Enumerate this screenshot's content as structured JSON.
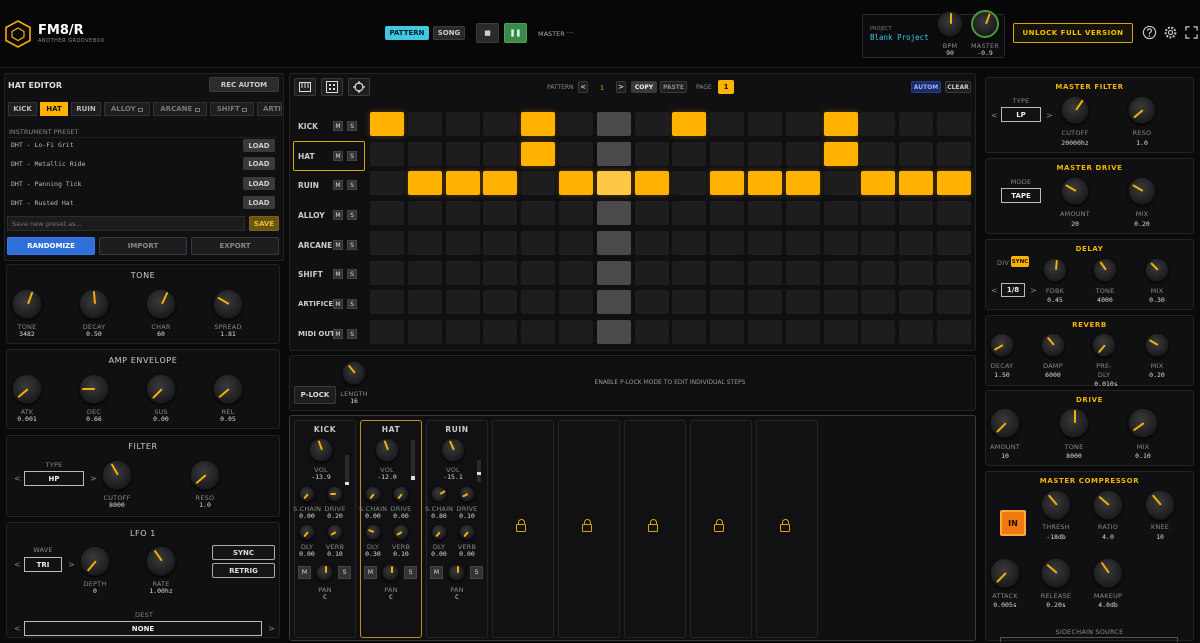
{
  "app": {
    "logo_title": "FM8/R",
    "logo_subtitle": "ANOTHER GROOVEBOX"
  },
  "transport": {
    "pattern_label": "PATTERN",
    "song_label": "SONG",
    "stop_glyph": "■",
    "pause_glyph": "❚❚",
    "master_label": "MASTER",
    "master_value": "---"
  },
  "project": {
    "label": "PROJECT",
    "name": "Blank Project",
    "bpm_label": "BPM",
    "bpm_value": "90",
    "master_label": "MASTER",
    "master_value": "-0.9",
    "unlock_label": "UNLOCK FULL VERSION"
  },
  "editor": {
    "title": "HAT EDITOR",
    "rec_label": "REC AUTOM",
    "tabs": [
      "KICK",
      "HAT",
      "RUIN",
      "ALLOY",
      "ARCANE",
      "SHIFT",
      "ARTI"
    ],
    "preset_heading": "INSTRUMENT PRESET",
    "presets": [
      {
        "name": "DHT - Lo-Fi Grit",
        "action": "LOAD"
      },
      {
        "name": "DHT - Metallic Ride",
        "action": "LOAD"
      },
      {
        "name": "DHT - Panning Tick",
        "action": "LOAD"
      },
      {
        "name": "DHT - Rusted Hat",
        "action": "LOAD"
      }
    ],
    "save_placeholder": "Save new preset as...",
    "save_label": "SAVE",
    "randomize_label": "RANDOMIZE",
    "import_label": "IMPORT",
    "export_label": "EXPORT",
    "tone": {
      "title": "TONE",
      "knobs": [
        {
          "label": "TONE",
          "value": "3482"
        },
        {
          "label": "DECAY",
          "value": "0.50"
        },
        {
          "label": "CHAR",
          "value": "60"
        },
        {
          "label": "SPREAD",
          "value": "1.81"
        }
      ]
    },
    "amp": {
      "title": "AMP ENVELOPE",
      "knobs": [
        {
          "label": "ATK",
          "value": "0.001"
        },
        {
          "label": "DEC",
          "value": "0.66"
        },
        {
          "label": "SUS",
          "value": "0.00"
        },
        {
          "label": "REL",
          "value": "0.05"
        }
      ]
    },
    "filter": {
      "title": "FILTER",
      "type_label": "TYPE",
      "type_value": "HP",
      "arrow_left": "<",
      "arrow_right": ">",
      "knobs": [
        {
          "label": "CUTOFF",
          "value": "8000"
        },
        {
          "label": "RESO",
          "value": "1.0"
        }
      ]
    },
    "lfo": {
      "title": "LFO 1",
      "wave_label": "WAVE",
      "wave_value": "TRI",
      "arrow_left": "<",
      "arrow_right": ">",
      "knobs": [
        {
          "label": "DEPTH",
          "value": "0"
        },
        {
          "label": "RATE",
          "value": "1.00hz"
        }
      ],
      "sync_label": "SYNC",
      "retrig_label": "RETRIG",
      "dest_label": "DEST",
      "dest_value": "NONE"
    }
  },
  "sequencer": {
    "pattern_label": "PATTERN",
    "pattern_prev": "<",
    "pattern_value": "1",
    "pattern_next": ">",
    "copy_label": "COPY",
    "paste_label": "PASTE",
    "page_label": "PAGE",
    "page_value": "1",
    "autom_label": "AUTOM",
    "clear_label": "CLEAR",
    "mute_label": "M",
    "solo_label": "S",
    "tracks": [
      {
        "name": "KICK",
        "steps": [
          1,
          0,
          0,
          0,
          1,
          0,
          0,
          0,
          1,
          0,
          0,
          0,
          1,
          0,
          0,
          0
        ]
      },
      {
        "name": "HAT",
        "steps": [
          0,
          0,
          0,
          0,
          1,
          0,
          0,
          0,
          0,
          0,
          0,
          0,
          1,
          0,
          0,
          0
        ]
      },
      {
        "name": "RUIN",
        "steps": [
          0,
          1,
          1,
          1,
          0,
          1,
          1,
          1,
          0,
          1,
          1,
          1,
          0,
          1,
          1,
          1
        ]
      },
      {
        "name": "ALLOY",
        "steps": [
          0,
          0,
          0,
          0,
          0,
          0,
          0,
          0,
          0,
          0,
          0,
          0,
          0,
          0,
          0,
          0
        ]
      },
      {
        "name": "ARCANE",
        "steps": [
          0,
          0,
          0,
          0,
          0,
          0,
          0,
          0,
          0,
          0,
          0,
          0,
          0,
          0,
          0,
          0
        ]
      },
      {
        "name": "SHIFT",
        "steps": [
          0,
          0,
          0,
          0,
          0,
          0,
          0,
          0,
          0,
          0,
          0,
          0,
          0,
          0,
          0,
          0
        ]
      },
      {
        "name": "ARTIFICE",
        "steps": [
          0,
          0,
          0,
          0,
          0,
          0,
          0,
          0,
          0,
          0,
          0,
          0,
          0,
          0,
          0,
          0
        ]
      },
      {
        "name": "MIDI OUT",
        "steps": [
          0,
          0,
          0,
          0,
          0,
          0,
          0,
          0,
          0,
          0,
          0,
          0,
          0,
          0,
          0,
          0
        ]
      }
    ],
    "playhead_step": 6,
    "plock_label": "P-LOCK",
    "length_label": "LENGTH",
    "length_value": "16",
    "hint": "ENABLE P-LOCK MODE TO EDIT INDIVIDUAL STEPS"
  },
  "mixer": {
    "channels": [
      {
        "name": "KICK",
        "vol": "-13.9",
        "schain": "0.00",
        "drive": "0.20",
        "dly": "0.00",
        "verb": "0.10",
        "pan": "C"
      },
      {
        "name": "HAT",
        "vol": "-12.0",
        "schain": "0.00",
        "drive": "0.00",
        "dly": "0.30",
        "verb": "0.10",
        "pan": "C"
      },
      {
        "name": "RUIN",
        "vol": "-15.1",
        "schain": "0.80",
        "drive": "0.10",
        "dly": "0.00",
        "verb": "0.00",
        "pan": "C"
      }
    ],
    "vol_label": "VOL",
    "schain_label": "S.CHAIN",
    "drive_label": "DRIVE",
    "dly_label": "DLY",
    "verb_label": "VERB",
    "pan_label": "PAN",
    "m_label": "M",
    "s_label": "S"
  },
  "fx": {
    "master_filter": {
      "title": "MASTER FILTER",
      "type_label": "TYPE",
      "type_value": "LP",
      "knobs": [
        {
          "label": "CUTOFF",
          "value": "20000hz"
        },
        {
          "label": "RESO",
          "value": "1.0"
        }
      ]
    },
    "master_drive": {
      "title": "MASTER DRIVE",
      "mode_label": "MODE",
      "mode_value": "TAPE",
      "knobs": [
        {
          "label": "AMOUNT",
          "value": "20"
        },
        {
          "label": "MIX",
          "value": "0.20"
        }
      ]
    },
    "delay": {
      "title": "DELAY",
      "div_label": "DIV",
      "sync_label": "SYNC",
      "div_value": "1/8",
      "knobs": [
        {
          "label": "FDBK",
          "value": "0.45"
        },
        {
          "label": "TONE",
          "value": "4000"
        },
        {
          "label": "MIX",
          "value": "0.30"
        }
      ]
    },
    "reverb": {
      "title": "REVERB",
      "knobs": [
        {
          "label": "DECAY",
          "value": "1.50"
        },
        {
          "label": "DAMP",
          "value": "6000"
        },
        {
          "label": "PRE-DLY",
          "value": "0.010s"
        },
        {
          "label": "MIX",
          "value": "0.20"
        }
      ]
    },
    "drive": {
      "title": "DRIVE",
      "knobs": [
        {
          "label": "AMOUNT",
          "value": "10"
        },
        {
          "label": "TONE",
          "value": "8000"
        },
        {
          "label": "MIX",
          "value": "0.10"
        }
      ]
    },
    "compressor": {
      "title": "MASTER COMPRESSOR",
      "in_label": "IN",
      "knobs": [
        {
          "label": "THRESH",
          "value": "-18db"
        },
        {
          "label": "RATIO",
          "value": "4.0"
        },
        {
          "label": "KNEE",
          "value": "10"
        },
        {
          "label": "ATTACK",
          "value": "0.005s"
        },
        {
          "label": "RELEASE",
          "value": "0.20s"
        },
        {
          "label": "MAKEUP",
          "value": "4.0db"
        }
      ],
      "sidechain_label": "SIDECHAIN SOURCE"
    }
  },
  "colors": {
    "accent": "#ffb300",
    "cyan": "#43c6e0",
    "play_green": "#3a8a4a",
    "randomize_blue": "#2f6fd8",
    "compressor_orange": "#f07a10"
  }
}
